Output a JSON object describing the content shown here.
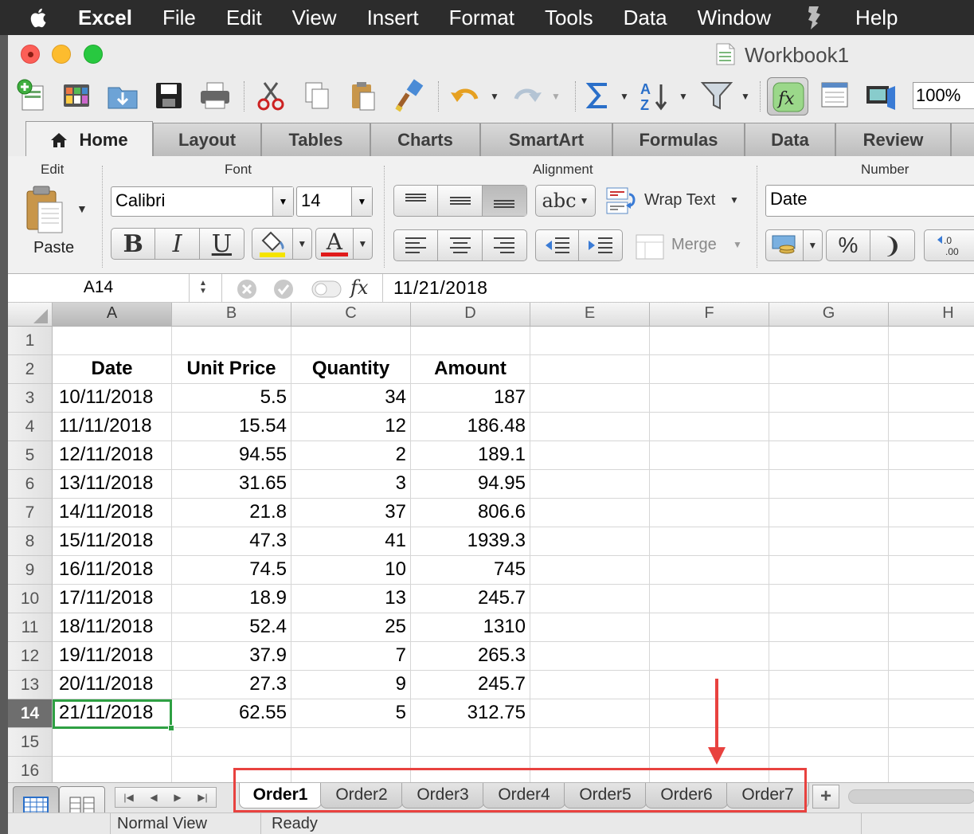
{
  "menubar": {
    "app": "Excel",
    "items": [
      "File",
      "Edit",
      "View",
      "Insert",
      "Format",
      "Tools",
      "Data",
      "Window",
      "Help"
    ]
  },
  "window": {
    "title": "Workbook1"
  },
  "toolbar": {
    "zoom": "100%"
  },
  "ribbon_tabs": [
    "Home",
    "Layout",
    "Tables",
    "Charts",
    "SmartArt",
    "Formulas",
    "Data",
    "Review"
  ],
  "ribbon": {
    "groups": {
      "edit": "Edit",
      "font": "Font",
      "alignment": "Alignment",
      "number": "Number"
    },
    "paste_label": "Paste",
    "font_name": "Calibri",
    "font_size": "14",
    "bold": "B",
    "italic": "I",
    "underline": "U",
    "font_color_letter": "A",
    "orientation_label": "abc",
    "wrap_text": "Wrap Text",
    "merge": "Merge",
    "number_format": "Date",
    "percent": "%",
    "comma": ")",
    "increase_decimal": "←.0 .00",
    "colors": {
      "fill": "#f5e400",
      "font": "#e01b1b"
    }
  },
  "formula_bar": {
    "cell_ref": "A14",
    "fx": "fx",
    "value": "11/21/2018"
  },
  "sheet": {
    "columns": [
      "A",
      "B",
      "C",
      "D",
      "E",
      "F",
      "G",
      "H"
    ],
    "rows": [
      "1",
      "2",
      "3",
      "4",
      "5",
      "6",
      "7",
      "8",
      "9",
      "10",
      "11",
      "12",
      "13",
      "14",
      "15",
      "16"
    ],
    "headers": [
      "Date",
      "Unit Price",
      "Quantity",
      "Amount"
    ],
    "data": [
      [
        "10/11/2018",
        "5.5",
        "34",
        "187"
      ],
      [
        "11/11/2018",
        "15.54",
        "12",
        "186.48"
      ],
      [
        "12/11/2018",
        "94.55",
        "2",
        "189.1"
      ],
      [
        "13/11/2018",
        "31.65",
        "3",
        "94.95"
      ],
      [
        "14/11/2018",
        "21.8",
        "37",
        "806.6"
      ],
      [
        "15/11/2018",
        "47.3",
        "41",
        "1939.3"
      ],
      [
        "16/11/2018",
        "74.5",
        "10",
        "745"
      ],
      [
        "17/11/2018",
        "18.9",
        "13",
        "245.7"
      ],
      [
        "18/11/2018",
        "52.4",
        "25",
        "1310"
      ],
      [
        "19/11/2018",
        "37.9",
        "7",
        "265.3"
      ],
      [
        "20/11/2018",
        "27.3",
        "9",
        "245.7"
      ],
      [
        "21/11/2018",
        "62.55",
        "5",
        "312.75"
      ]
    ],
    "selected_cell": "A14"
  },
  "sheet_tabs": [
    "Order1",
    "Order2",
    "Order3",
    "Order4",
    "Order5",
    "Order6",
    "Order7"
  ],
  "active_sheet": "Order1",
  "add_sheet": "+",
  "status": {
    "view": "Normal View",
    "state": "Ready"
  },
  "annotation_color": "#e8423f"
}
